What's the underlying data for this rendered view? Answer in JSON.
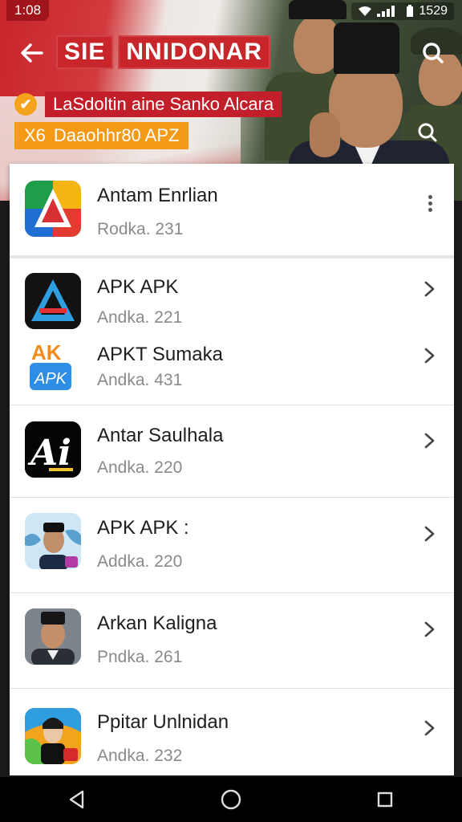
{
  "status_bar": {
    "time": "1:08",
    "right_text": "1529"
  },
  "header": {
    "title_part1": "SIE",
    "title_part2": "NNIDONAR",
    "promo_line1": "LaSdoltin aine Sanko Alcara",
    "promo_line2_icon": "X6",
    "promo_line2": "Daaohhr80 APZ"
  },
  "featured": {
    "name": "Antam Enrlian",
    "sub": "Rodka. 231"
  },
  "list": [
    {
      "name": "APK APK",
      "sub": "Andka. 221",
      "icon": "apk-triangle-icon"
    },
    {
      "name": "APKT Sumaka",
      "sub": "Andka. 431",
      "icon": "apk-orange-icon",
      "icon_text_top": "AK",
      "icon_text_bottom": "APK"
    },
    {
      "name": "Antar Saulhala",
      "sub": "Andka. 220",
      "icon": "ai-black-icon",
      "icon_text": "Ai"
    },
    {
      "name": "APK APK :",
      "sub": "Addka. 220",
      "icon": "portrait-map-icon"
    },
    {
      "name": "Arkan Kaligna",
      "sub": "Pndka. 261",
      "icon": "portrait-icon"
    },
    {
      "name": "Ppitar Unlnidan",
      "sub": "Andka. 232",
      "icon": "portrait-cartoon-icon"
    }
  ],
  "colors": {
    "brand_red": "#c9262b",
    "orange": "#f59a16",
    "text": "#1e1e1e",
    "muted": "#8a8a8a"
  }
}
